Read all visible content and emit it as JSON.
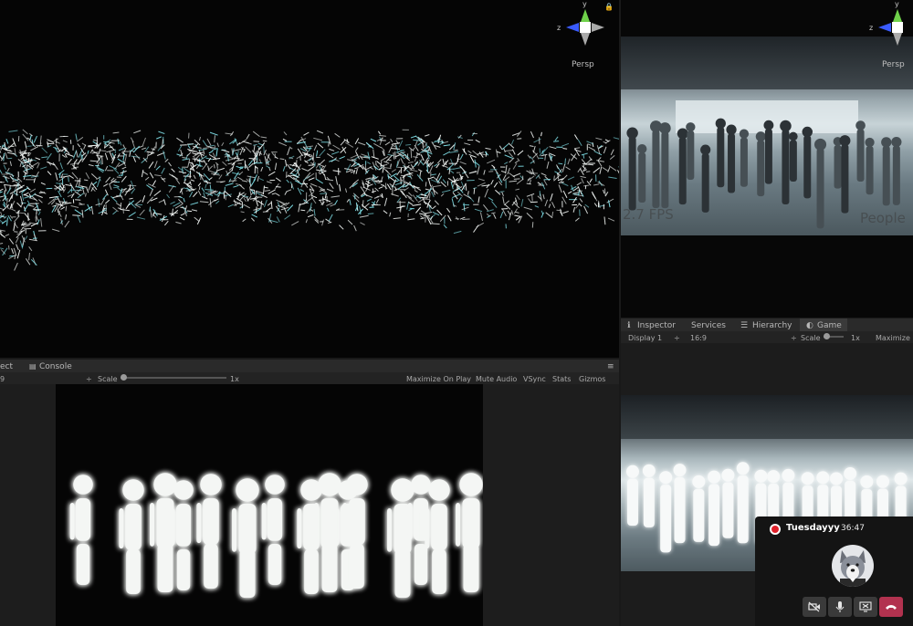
{
  "scene_view": {
    "gizmo": {
      "axis_y": "y",
      "axis_z": "z",
      "projection": "Persp"
    }
  },
  "left_panel": {
    "tabs": [
      "ect",
      "Console"
    ],
    "toolbar": {
      "aspect": "9",
      "scale_label": "Scale",
      "scale_value": "1x",
      "buttons": [
        "Maximize On Play",
        "Mute Audio",
        "VSync",
        "Stats",
        "Gizmos"
      ]
    }
  },
  "right_scene_view": {
    "gizmo": {
      "axis_y": "y",
      "axis_z": "z",
      "projection": "Persp"
    },
    "video_overlay": {
      "fps_text": "2.7 FPS",
      "people_text": "People"
    }
  },
  "right_panel": {
    "tabs": [
      {
        "label": "Inspector",
        "icon": "info-icon"
      },
      {
        "label": "Services",
        "icon": ""
      },
      {
        "label": "Hierarchy",
        "icon": "list-icon"
      },
      {
        "label": "Game",
        "icon": "game-icon"
      }
    ],
    "toolbar": {
      "display": "Display 1",
      "aspect": "16:9",
      "scale_label": "Scale",
      "scale_value": "1x",
      "maximize": "Maximize"
    }
  },
  "call_widget": {
    "title": "Tuesdayyy",
    "timer": "36:47",
    "recording_color": "#e0202a",
    "end_call_color": "#b2324f",
    "buttons": [
      "video-off-icon",
      "microphone-icon",
      "share-screen-icon",
      "end-call-icon"
    ]
  }
}
